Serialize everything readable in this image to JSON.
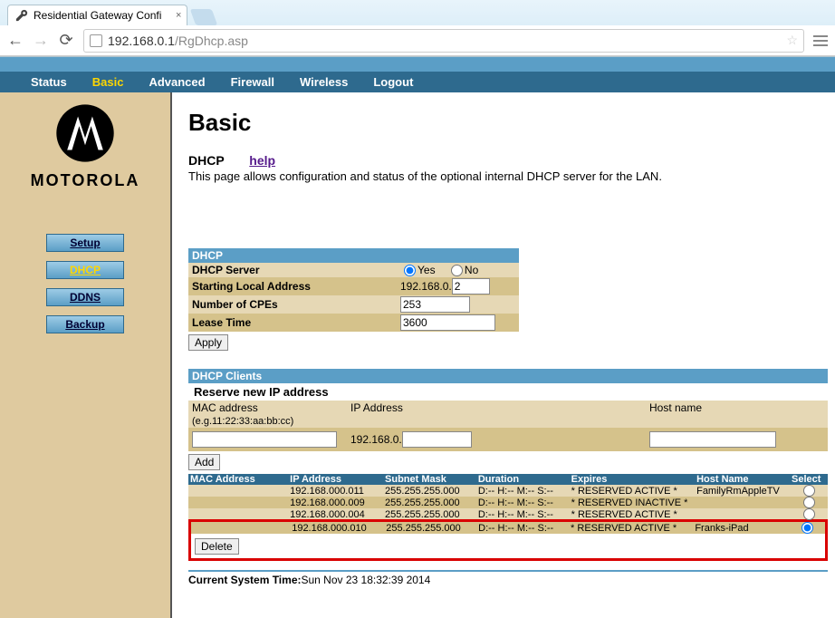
{
  "browser": {
    "tabTitle": "Residential Gateway Confi",
    "url": {
      "full": "192.168.0.1/RgDhcp.asp",
      "host": "192.168.0.1",
      "path": "/RgDhcp.asp"
    }
  },
  "topnav": {
    "items": [
      {
        "label": "Status",
        "active": false
      },
      {
        "label": "Basic",
        "active": true
      },
      {
        "label": "Advanced",
        "active": false
      },
      {
        "label": "Firewall",
        "active": false
      },
      {
        "label": "Wireless",
        "active": false
      },
      {
        "label": "Logout",
        "active": false
      }
    ]
  },
  "brand": "MOTOROLA",
  "sidebar": {
    "items": [
      {
        "label": "Setup",
        "active": false
      },
      {
        "label": "DHCP",
        "active": true
      },
      {
        "label": "DDNS",
        "active": false
      },
      {
        "label": "Backup",
        "active": false
      }
    ]
  },
  "page": {
    "title": "Basic",
    "subLabel": "DHCP",
    "helpLabel": "help",
    "description": "This page allows configuration and status of the optional internal DHCP server for the LAN."
  },
  "dhcp": {
    "sectionTitle": "DHCP",
    "serverLabel": "DHCP Server",
    "yes": "Yes",
    "no": "No",
    "serverValue": "yes",
    "startLabel": "Starting Local Address",
    "startPrefix": "192.168.0.",
    "startValue": "2",
    "cpeLabel": "Number of CPEs",
    "cpeValue": "253",
    "leaseLabel": "Lease Time",
    "leaseValue": "3600",
    "applyLabel": "Apply"
  },
  "clients": {
    "sectionTitle": "DHCP Clients",
    "reserveTitle": "Reserve new IP address",
    "macLabel": "MAC address",
    "macHint": "(e.g.11:22:33:aa:bb:cc)",
    "ipLabel": "IP Address",
    "ipPrefix": "192.168.0.",
    "hostLabel": "Host name",
    "addLabel": "Add",
    "cols": {
      "mac": "MAC Address",
      "ip": "IP Address",
      "mask": "Subnet Mask",
      "dur": "Duration",
      "exp": "Expires",
      "host": "Host Name",
      "sel": "Select"
    },
    "rows": [
      {
        "mac": "",
        "ip": "192.168.000.011",
        "mask": "255.255.255.000",
        "dur": "D:-- H:-- M:-- S:--",
        "exp": "* RESERVED ACTIVE *",
        "host": "FamilyRmAppleTV",
        "highlight": false
      },
      {
        "mac": "",
        "ip": "192.168.000.009",
        "mask": "255.255.255.000",
        "dur": "D:-- H:-- M:-- S:--",
        "exp": "* RESERVED INACTIVE *",
        "host": "",
        "highlight": false
      },
      {
        "mac": "",
        "ip": "192.168.000.004",
        "mask": "255.255.255.000",
        "dur": "D:-- H:-- M:-- S:--",
        "exp": "* RESERVED ACTIVE *",
        "host": "",
        "highlight": false
      },
      {
        "mac": "",
        "ip": "192.168.000.010",
        "mask": "255.255.255.000",
        "dur": "D:-- H:-- M:-- S:--",
        "exp": "* RESERVED ACTIVE *",
        "host": "Franks-iPad",
        "highlight": true,
        "selected": true
      }
    ],
    "deleteLabel": "Delete"
  },
  "systime": {
    "label": "Current System Time:",
    "value": "Sun Nov 23 18:32:39 2014"
  }
}
